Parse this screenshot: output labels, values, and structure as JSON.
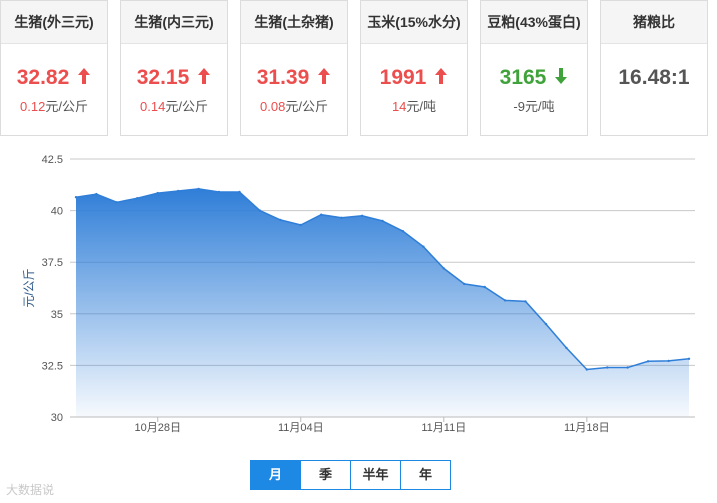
{
  "cards": [
    {
      "name": "生猪(外三元)",
      "price": "32.82",
      "direction": "up",
      "change": "0.12",
      "unit": "元/公斤"
    },
    {
      "name": "生猪(内三元)",
      "price": "32.15",
      "direction": "up",
      "change": "0.14",
      "unit": "元/公斤"
    },
    {
      "name": "生猪(土杂猪)",
      "price": "31.39",
      "direction": "up",
      "change": "0.08",
      "unit": "元/公斤"
    },
    {
      "name": "玉米(15%水分)",
      "price": "1991",
      "direction": "up",
      "change": "14",
      "unit": "元/吨"
    },
    {
      "name": "豆粕(43%蛋白)",
      "price": "3165",
      "direction": "down",
      "change": "-9",
      "unit": "元/吨"
    },
    {
      "name": "猪粮比",
      "price": "16.48:1",
      "direction": "none",
      "change": "",
      "unit": ""
    }
  ],
  "colors": {
    "up": "#ec4d4d",
    "down": "#3fa23a",
    "accent": "#1e88e5",
    "series": "#2f7ed8"
  },
  "period_tabs": [
    "月",
    "季",
    "半年",
    "年"
  ],
  "active_tab": "月",
  "watermark": "大数据说",
  "chart_data": {
    "type": "area",
    "ylabel": "元/公斤",
    "ylim": [
      30,
      42.5
    ],
    "yticks": [
      "42.5",
      "40",
      "37.5",
      "35",
      "32.5",
      "30"
    ],
    "xtick_labels": [
      "10月28日",
      "11月04日",
      "11月11日",
      "11月18日"
    ],
    "xtick_index": [
      4,
      11,
      18,
      25
    ],
    "grid": true,
    "legend": "none",
    "series": [
      {
        "values": [
          40.65,
          40.8,
          40.4,
          40.6,
          40.85,
          40.95,
          41.05,
          40.9,
          40.9,
          40.0,
          39.55,
          39.3,
          39.8,
          39.65,
          39.75,
          39.5,
          39.0,
          38.25,
          37.2,
          36.45,
          36.3,
          35.65,
          35.6,
          34.5,
          33.35,
          32.3,
          32.4,
          32.4,
          32.7,
          32.72,
          32.82
        ]
      }
    ]
  }
}
